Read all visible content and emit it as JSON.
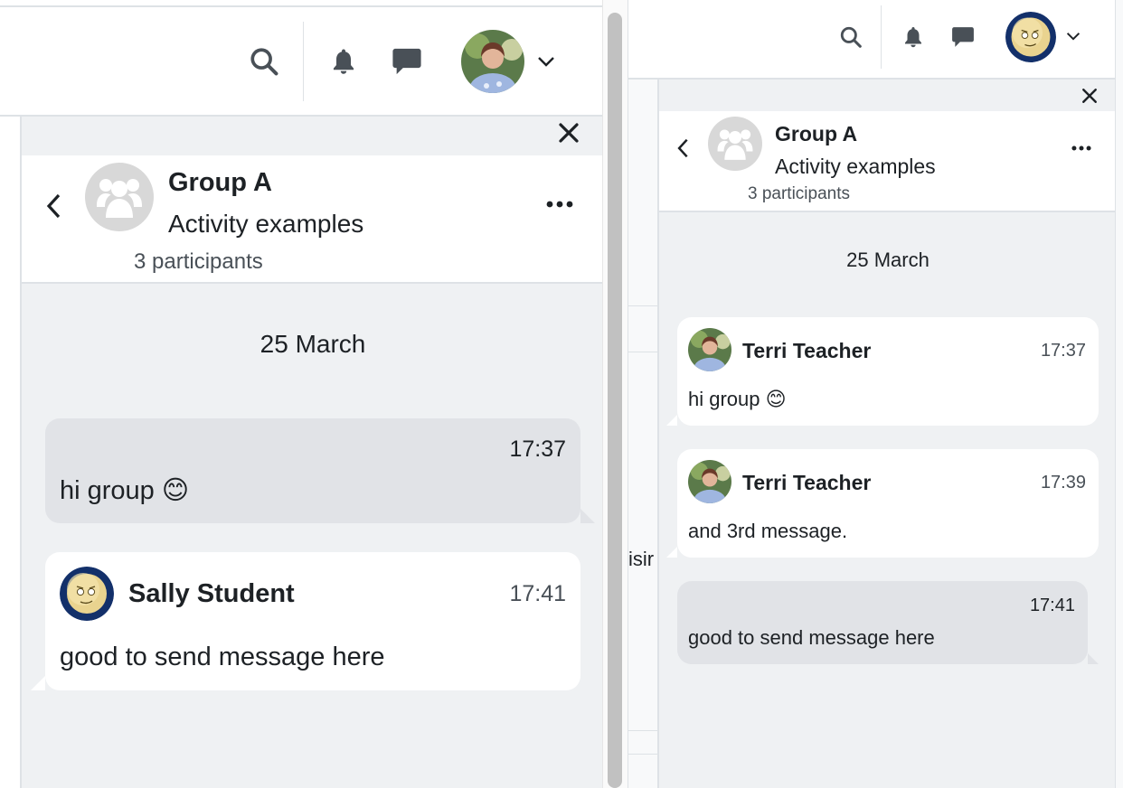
{
  "left_window": {
    "conversation": {
      "group_name": "Group A",
      "subtitle": "Activity examples",
      "participants": "3 participants",
      "date_label": "25 March",
      "messages": [
        {
          "time": "17:37",
          "text": "hi group 😊"
        },
        {
          "sender": "Sally Student",
          "time": "17:41",
          "text": "good to send message here"
        }
      ]
    },
    "icons": {
      "search": "search-icon",
      "notifications": "bell-icon",
      "messages": "chat-icon",
      "user_menu": "chevron-down-icon",
      "close": "close-icon",
      "back": "chevron-left-icon",
      "menu": "more-icon"
    }
  },
  "right_window": {
    "conversation": {
      "group_name": "Group A",
      "subtitle": "Activity examples",
      "participants": "3 participants",
      "date_label": "25 March",
      "messages": [
        {
          "sender": "Terri Teacher",
          "time": "17:37",
          "text": "hi group 😊"
        },
        {
          "sender": "Terri Teacher",
          "time": "17:39",
          "text": "and 3rd message."
        },
        {
          "time": "17:41",
          "text": "good to send message here"
        }
      ]
    },
    "background_text": "isir"
  },
  "colors": {
    "own_bubble": "#e1e3e7",
    "other_bubble": "#ffffff",
    "drawer_bg": "#eff1f3",
    "icon": "#495057"
  }
}
